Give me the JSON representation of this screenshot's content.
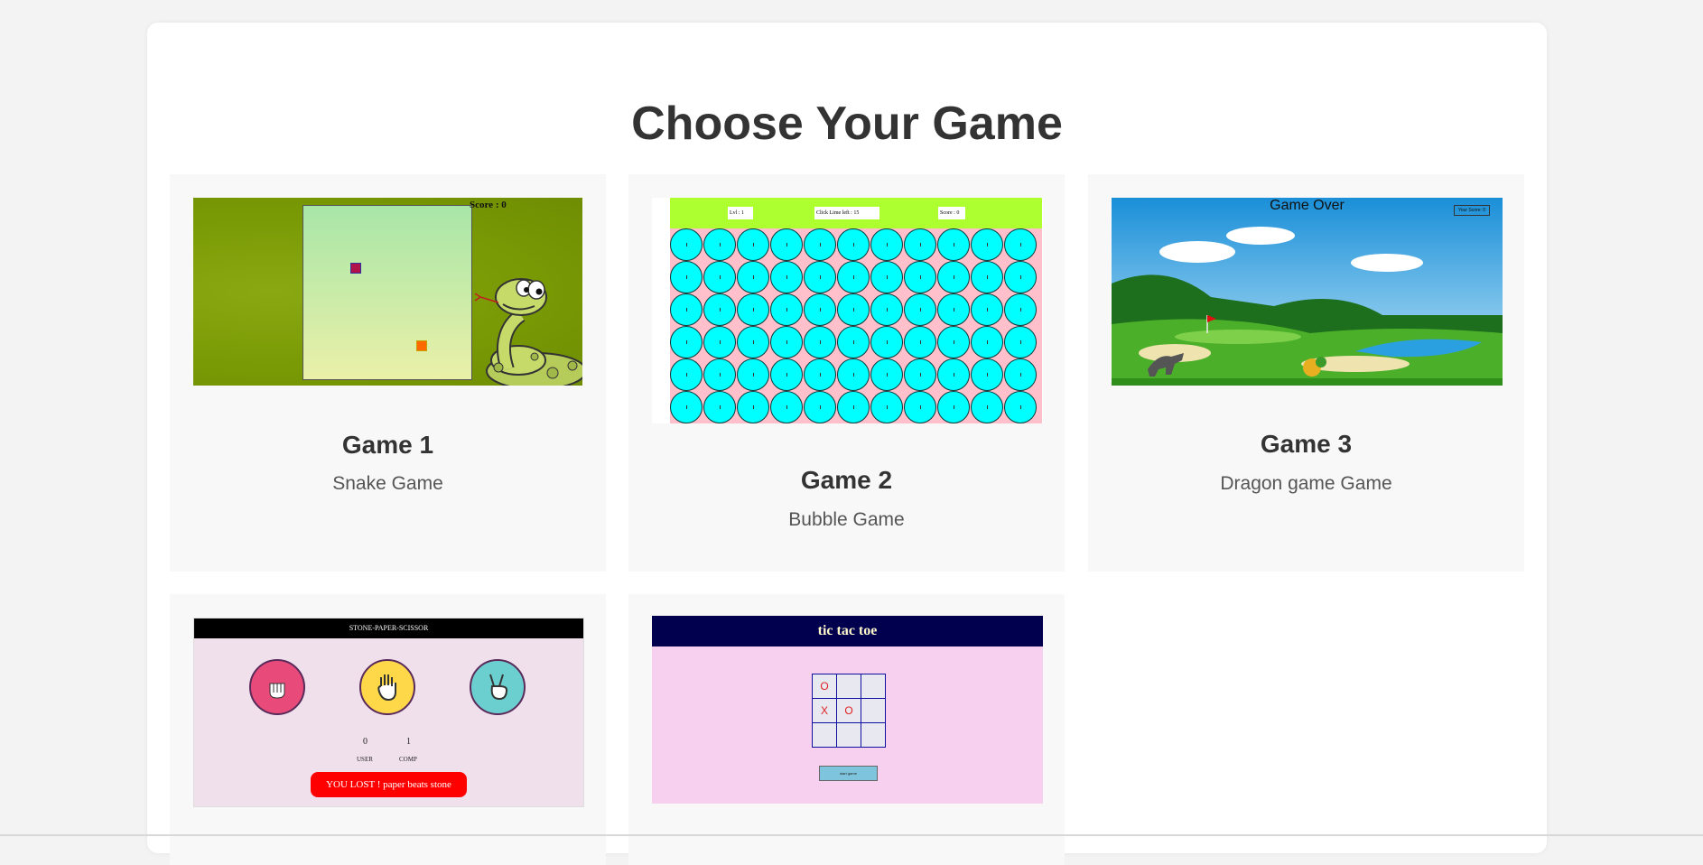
{
  "page": {
    "title": "Choose Your Game"
  },
  "games": [
    {
      "title": "Game 1",
      "description": "Snake Game",
      "preview": {
        "score_text": "Score : 0"
      }
    },
    {
      "title": "Game 2",
      "description": "Bubble Game",
      "preview": {
        "header_left": "Lvl : 1",
        "header_center": "Click Lime left : 15",
        "header_right": "Score : 0"
      }
    },
    {
      "title": "Game 3",
      "description": "Dragon game Game",
      "preview": {
        "status_text": "Game Over",
        "score_button": "Your Score: 0"
      }
    },
    {
      "preview": {
        "header": "STONE-PAPER-SCISSOR",
        "user_score": "0",
        "comp_score": "1",
        "user_label": "USER",
        "comp_label": "COMP",
        "result": "YOU LOST ! paper beats stone"
      }
    },
    {
      "preview": {
        "header": "tic tac toe",
        "cells": [
          "O",
          "",
          "",
          "X",
          "O",
          "",
          "",
          "",
          ""
        ],
        "button": "start game"
      }
    }
  ],
  "colors": {
    "background": "#f3f3f3",
    "panel": "#ffffff",
    "card": "#f8f8f8",
    "bubble": "#00ffff",
    "bubble_header": "#adff2f",
    "rps_result": "#ff0000",
    "ttt_header": "#00004f"
  }
}
